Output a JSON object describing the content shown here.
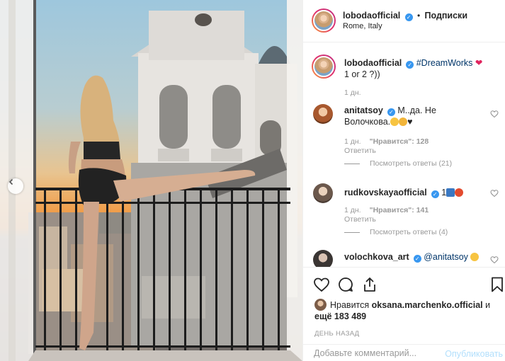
{
  "post": {
    "author": "lobodaofficial",
    "follow_label": "Подписки",
    "location": "Rome, Italy"
  },
  "caption": {
    "username": "lobodaofficial",
    "hashtag": "#DreamWorks",
    "text_line2": "1 or 2 ?))",
    "time": "1 дн."
  },
  "comments": [
    {
      "username": "anitatsoy",
      "text": "М..да. Не Волочкова.",
      "time": "1 дн.",
      "likes": "\"Нравится\": 128",
      "reply": "Ответить",
      "view_replies": "Посмотреть ответы (21)"
    },
    {
      "username": "rudkovskayaofficial",
      "text": "1",
      "time": "1 дн.",
      "likes": "\"Нравится\": 141",
      "reply": "Ответить",
      "view_replies": "Посмотреть ответы (4)"
    },
    {
      "username": "volochkova_art",
      "mention": "@anitatsoy"
    }
  ],
  "likes_block": {
    "prefix": "Нравится",
    "username": "oksana.marchenko.official",
    "suffix": "и",
    "more": "ещё 183 489"
  },
  "date_label": "ДЕНЬ НАЗАД",
  "add_comment": {
    "placeholder": "Добавьте комментарий...",
    "publish": "Опубликовать"
  },
  "colors": {
    "link": "#003569",
    "verified": "#3897f0",
    "muted": "#999999",
    "publish_disabled": "#b2dffc"
  },
  "icons": [
    "chevron-left-icon",
    "heart-icon",
    "comment-icon",
    "share-icon",
    "bookmark-icon",
    "verified-badge-icon"
  ]
}
